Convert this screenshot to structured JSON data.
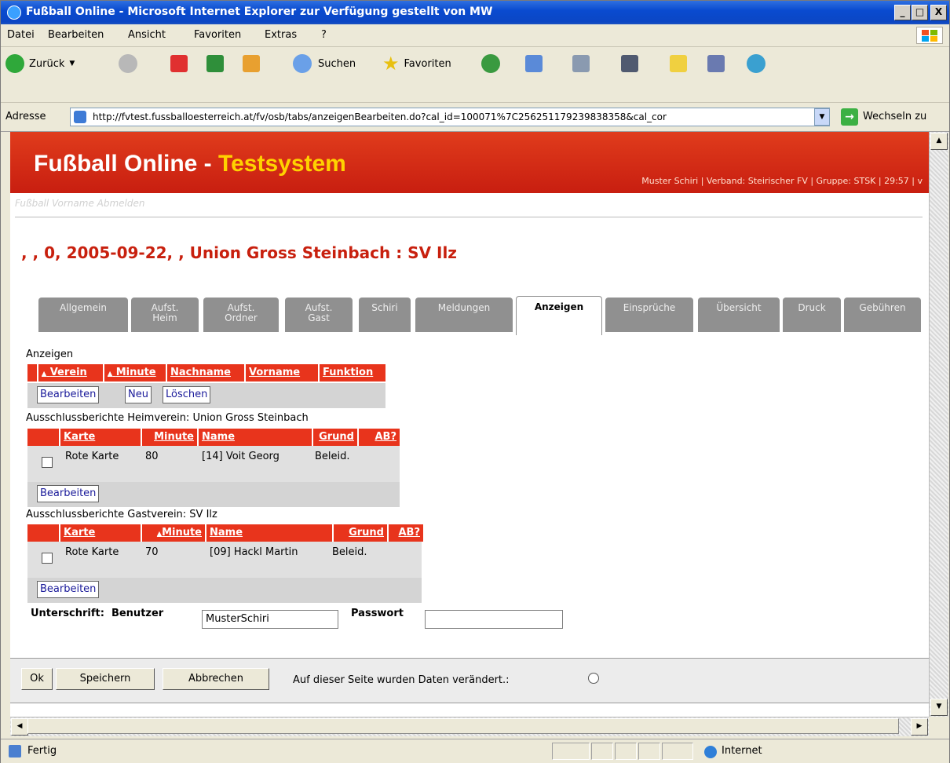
{
  "window": {
    "title": "Fußball Online - Microsoft Internet Explorer  zur Verfügung gestellt von MW"
  },
  "window_controls": {
    "minimize": "_",
    "maximize": "□",
    "close": "X"
  },
  "menu": [
    "Datei",
    "Bearbeiten",
    "Ansicht",
    "Favoriten",
    "Extras",
    "?"
  ],
  "toolbar": {
    "back": "Zurück",
    "search": "Suchen",
    "favorites": "Favoriten"
  },
  "address": {
    "label": "Adresse",
    "url": "http://fvtest.fussballoesterreich.at/fv/osb/tabs/anzeigenBearbeiten.do?cal_id=100071%7C256251179239838358&cal_cor",
    "go": "Wechseln zu"
  },
  "banner": {
    "title_main": "Fußball Online - ",
    "title_highlight": "Testsystem",
    "meta": "Muster Schiri | Verband: Steirischer FV | Gruppe: STSK | 29:57 | v"
  },
  "subnav": "Fußball  Vorname  Abmelden",
  "match_title": ", , 0, 2005-09-22, , Union Gross Steinbach : SV Ilz",
  "tabs": [
    {
      "l1": "Allgemein",
      "l2": ""
    },
    {
      "l1": "Aufst.",
      "l2": "Heim"
    },
    {
      "l1": "Aufst.",
      "l2": "Ordner"
    },
    {
      "l1": "Aufst.",
      "l2": "Gast"
    },
    {
      "l1": "Schiri",
      "l2": ""
    },
    {
      "l1": "Meldungen",
      "l2": ""
    },
    {
      "l1": "Anzeigen",
      "l2": ""
    },
    {
      "l1": "Einsprüche",
      "l2": ""
    },
    {
      "l1": "Übersicht",
      "l2": ""
    },
    {
      "l1": "Druck",
      "l2": ""
    },
    {
      "l1": "Gebühren",
      "l2": ""
    }
  ],
  "anzeigen": {
    "label": "Anzeigen",
    "columns": [
      "Verein",
      "Minute",
      "Nachname",
      "Vorname",
      "Funktion"
    ],
    "buttons": [
      "Bearbeiten",
      "Neu",
      "Löschen"
    ]
  },
  "heim": {
    "label": "Ausschlussberichte Heimverein: Union Gross Steinbach",
    "columns": [
      "Karte",
      "Minute",
      "Name",
      "Grund",
      "AB?"
    ],
    "row": {
      "karte": "Rote Karte",
      "minute": "80",
      "name": "[14] Voit Georg",
      "grund": "Beleid."
    },
    "button": "Bearbeiten"
  },
  "gast": {
    "label": "Ausschlussberichte Gastverein: SV Ilz",
    "columns": [
      "Karte",
      "Minute",
      "Name",
      "Grund",
      "AB?"
    ],
    "row": {
      "karte": "Rote Karte",
      "minute": "70",
      "name": "[09] Hackl Martin",
      "grund": "Beleid."
    },
    "button": "Bearbeiten"
  },
  "signature": {
    "label": "Unterschrift:",
    "user_label": "Benutzer",
    "user_value": "MusterSchiri",
    "pass_label": "Passwort",
    "pass_value": ""
  },
  "footer": {
    "ok": "Ok",
    "save": "Speichern",
    "cancel": "Abbrechen",
    "changed_text": "Auf dieser Seite wurden Daten verändert.:"
  },
  "status": {
    "text": "Fertig",
    "zone": "Internet"
  }
}
